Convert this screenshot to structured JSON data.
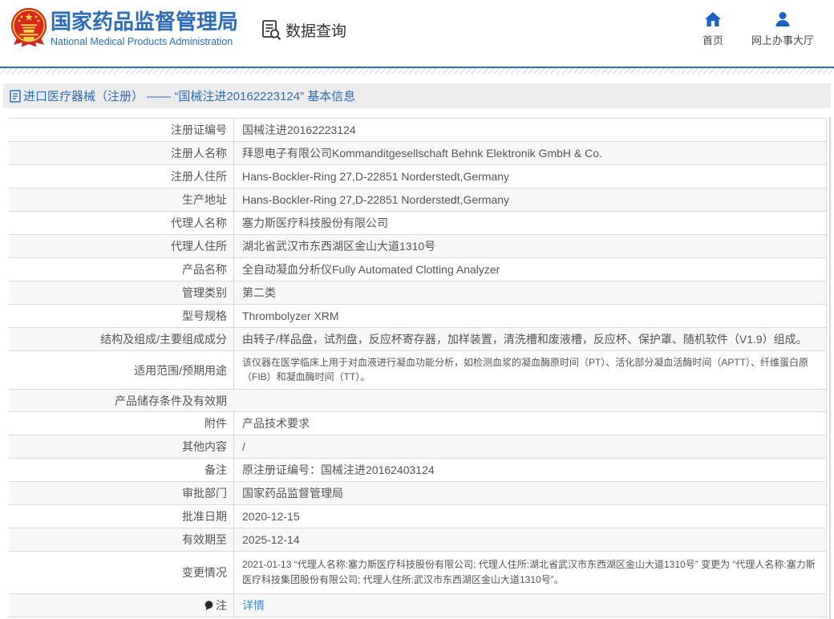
{
  "header": {
    "logo_title": "国家药品监督管理局",
    "logo_subtitle": "National Medical Products Administration",
    "section_title": "数据查询",
    "nav_home": "首页",
    "nav_hall": "网上办事大厅"
  },
  "breadcrumb": {
    "text": "进口医疗器械（注册） —— “国械注进20162223124” 基本信息"
  },
  "table": {
    "rows": [
      {
        "label": "注册证编号",
        "value": "国械注进20162223124"
      },
      {
        "label": "注册人名称",
        "value": "拜恩电子有限公司Kommanditgesellschaft Behnk Elektronik GmbH & Co."
      },
      {
        "label": "注册人住所",
        "value": "Hans-Bockler-Ring 27,D-22851 Norderstedt,Germany"
      },
      {
        "label": "生产地址",
        "value": "Hans-Bockler-Ring 27,D-22851 Norderstedt,Germany"
      },
      {
        "label": "代理人名称",
        "value": "塞力斯医疗科技股份有限公司"
      },
      {
        "label": "代理人住所",
        "value": "湖北省武汉市东西湖区金山大道1310号"
      },
      {
        "label": "产品名称",
        "value": "全自动凝血分析仪Fully Automated Clotting Analyzer"
      },
      {
        "label": "管理类别",
        "value": "第二类"
      },
      {
        "label": "型号规格",
        "value": "Thrombolyzer XRM"
      },
      {
        "label": "结构及组成/主要组成成分",
        "value": "由转子/样品盘，试剂盘，反应杯寄存器，加样装置，清洗槽和废液槽，反应杯、保护罩、随机软件（V1.9）组成。"
      },
      {
        "label": "适用范围/预期用途",
        "value": "该仪器在医学临床上用于对血液进行凝血功能分析，如检测血浆的凝血酶原时间（PT）、活化部分凝血活酶时间（APTT）、纤维蛋白原（FIB）和凝血酶时间（TT）。"
      },
      {
        "label": "产品储存条件及有效期",
        "value": ""
      },
      {
        "label": "附件",
        "value": "产品技术要求"
      },
      {
        "label": "其他内容",
        "value": "/"
      },
      {
        "label": "备注",
        "value": "原注册证编号：国械注进20162403124"
      },
      {
        "label": "审批部门",
        "value": "国家药品监督管理局"
      },
      {
        "label": "批准日期",
        "value": "2020-12-15"
      },
      {
        "label": "有效期至",
        "value": "2025-12-14"
      },
      {
        "label": "变更情况",
        "value": "2021-01-13 “代理人名称:塞力斯医疗科技股份有限公司; 代理人住所:湖北省武汉市东西湖区金山大道1310号” 变更为 “代理人名称:塞力斯医疗科技集团股份有限公司; 代理人住所:武汉市东西湖区金山大道1310号”。"
      },
      {
        "label": "注",
        "label_icon": "comment-icon",
        "value": "详情",
        "is_link": true
      }
    ]
  }
}
